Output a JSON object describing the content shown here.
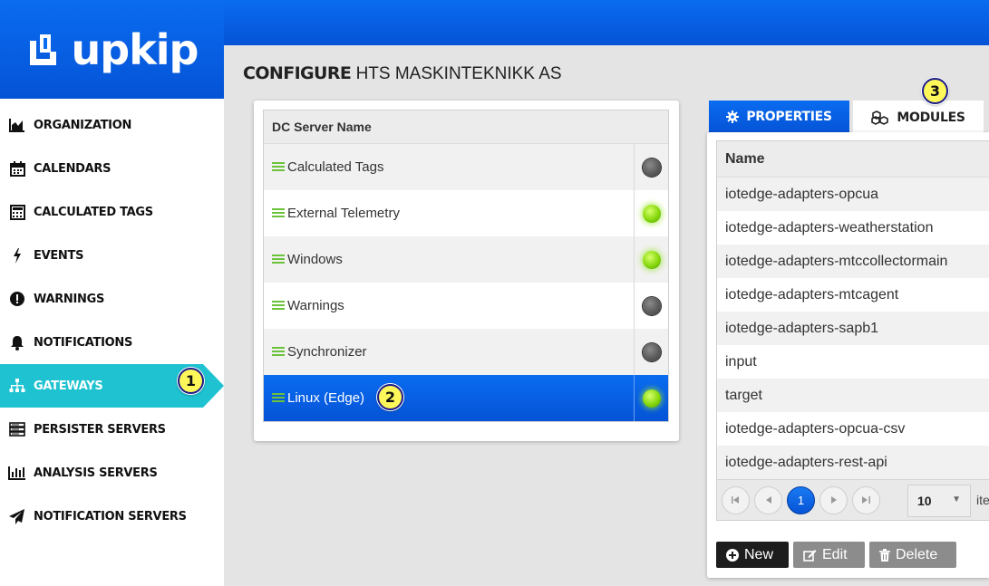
{
  "app": {
    "logo_text": "upkip"
  },
  "sidebar": {
    "items": [
      {
        "label": "ORGANIZATION",
        "icon": "area-chart-icon"
      },
      {
        "label": "CALENDARS",
        "icon": "calendar-icon"
      },
      {
        "label": "CALCULATED TAGS",
        "icon": "calculator-icon"
      },
      {
        "label": "EVENTS",
        "icon": "bolt-icon"
      },
      {
        "label": "WARNINGS",
        "icon": "exclamation-circle-icon"
      },
      {
        "label": "NOTIFICATIONS",
        "icon": "bell-icon"
      },
      {
        "label": "GATEWAYS",
        "icon": "sitemap-icon",
        "active": true
      },
      {
        "label": "PERSISTER SERVERS",
        "icon": "server-icon"
      },
      {
        "label": "ANALYSIS SERVERS",
        "icon": "bar-chart-icon"
      },
      {
        "label": "NOTIFICATION SERVERS",
        "icon": "paper-plane-icon"
      }
    ]
  },
  "header": {
    "title_bold": "CONFIGURE",
    "title_rest": "HTS MASKINTEKNIKK AS"
  },
  "dc_table": {
    "column": "DC Server Name",
    "rows": [
      {
        "name": "Calculated Tags",
        "status": "offline"
      },
      {
        "name": "External Telemetry",
        "status": "online"
      },
      {
        "name": "Windows",
        "status": "online"
      },
      {
        "name": "Warnings",
        "status": "offline"
      },
      {
        "name": "Synchronizer",
        "status": "offline"
      },
      {
        "name": "Linux (Edge)",
        "status": "online",
        "selected": true
      }
    ]
  },
  "tabs": {
    "properties": "PROPERTIES",
    "modules": "MODULES"
  },
  "modules_table": {
    "column": "Name",
    "rows": [
      "iotedge-adapters-opcua",
      "iotedge-adapters-weatherstation",
      "iotedge-adapters-mtccollectormain",
      "iotedge-adapters-mtcagent",
      "iotedge-adapters-sapb1",
      "input",
      "target",
      "iotedge-adapters-opcua-csv",
      "iotedge-adapters-rest-api"
    ],
    "pager": {
      "current_page": "1",
      "page_size": "10",
      "items_label": "ite"
    }
  },
  "actions": {
    "new": "New",
    "edit": "Edit",
    "delete": "Delete"
  },
  "callouts": {
    "one": "1",
    "two": "2",
    "three": "3"
  },
  "colors": {
    "brand_blue": "#0a6cf0",
    "active_teal": "#1fc2d0",
    "callout_yellow": "#fef75a",
    "status_green": "#86d80e"
  }
}
